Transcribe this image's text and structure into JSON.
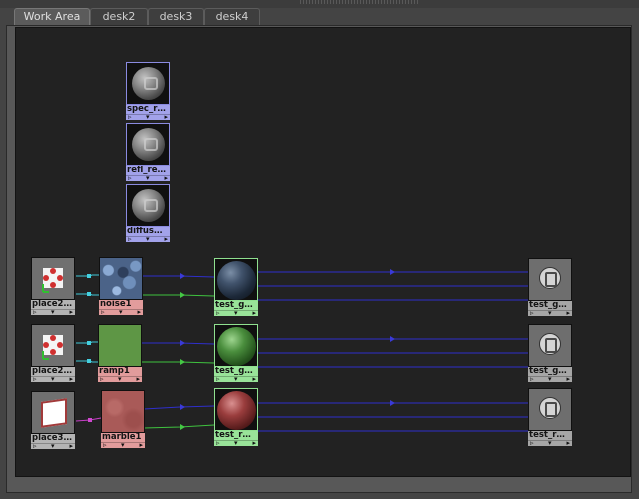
{
  "tabs": [
    {
      "label": "Work Area",
      "active": true
    },
    {
      "label": "desk2",
      "active": false
    },
    {
      "label": "desk3",
      "active": false
    },
    {
      "label": "desk4",
      "active": false
    }
  ],
  "nodes": {
    "spec": "spec_r…",
    "refl": "refl_re…",
    "diffuse": "diffus…",
    "place1": "place2…",
    "noise": "noise1",
    "mat1": "test_g…",
    "sg1": "test_g…",
    "place2": "place2…",
    "ramp": "ramp1",
    "mat2": "test_g…",
    "sg2": "test_g…",
    "place3": "place3…",
    "marble": "marble1",
    "mat3": "test_r…",
    "sg3": "test_r…"
  },
  "pins": {
    "left": "▹",
    "mid": "▾",
    "right": "▸"
  },
  "colors": {
    "canvas": "#222222",
    "shader_node": "#a2a2ea",
    "texture_node": "#e29c9c",
    "material_node": "#99e399",
    "wire_blue": "#2f2fcc",
    "wire_cyan": "#3fc8d8",
    "wire_green": "#3fc23f",
    "wire_magenta": "#c83fc8"
  },
  "icons": {
    "shader": "sphere-swatch-icon",
    "place2d": "place2d-texture-icon",
    "place3d": "place3d-cube-icon",
    "shading_group": "shading-group-icon"
  }
}
